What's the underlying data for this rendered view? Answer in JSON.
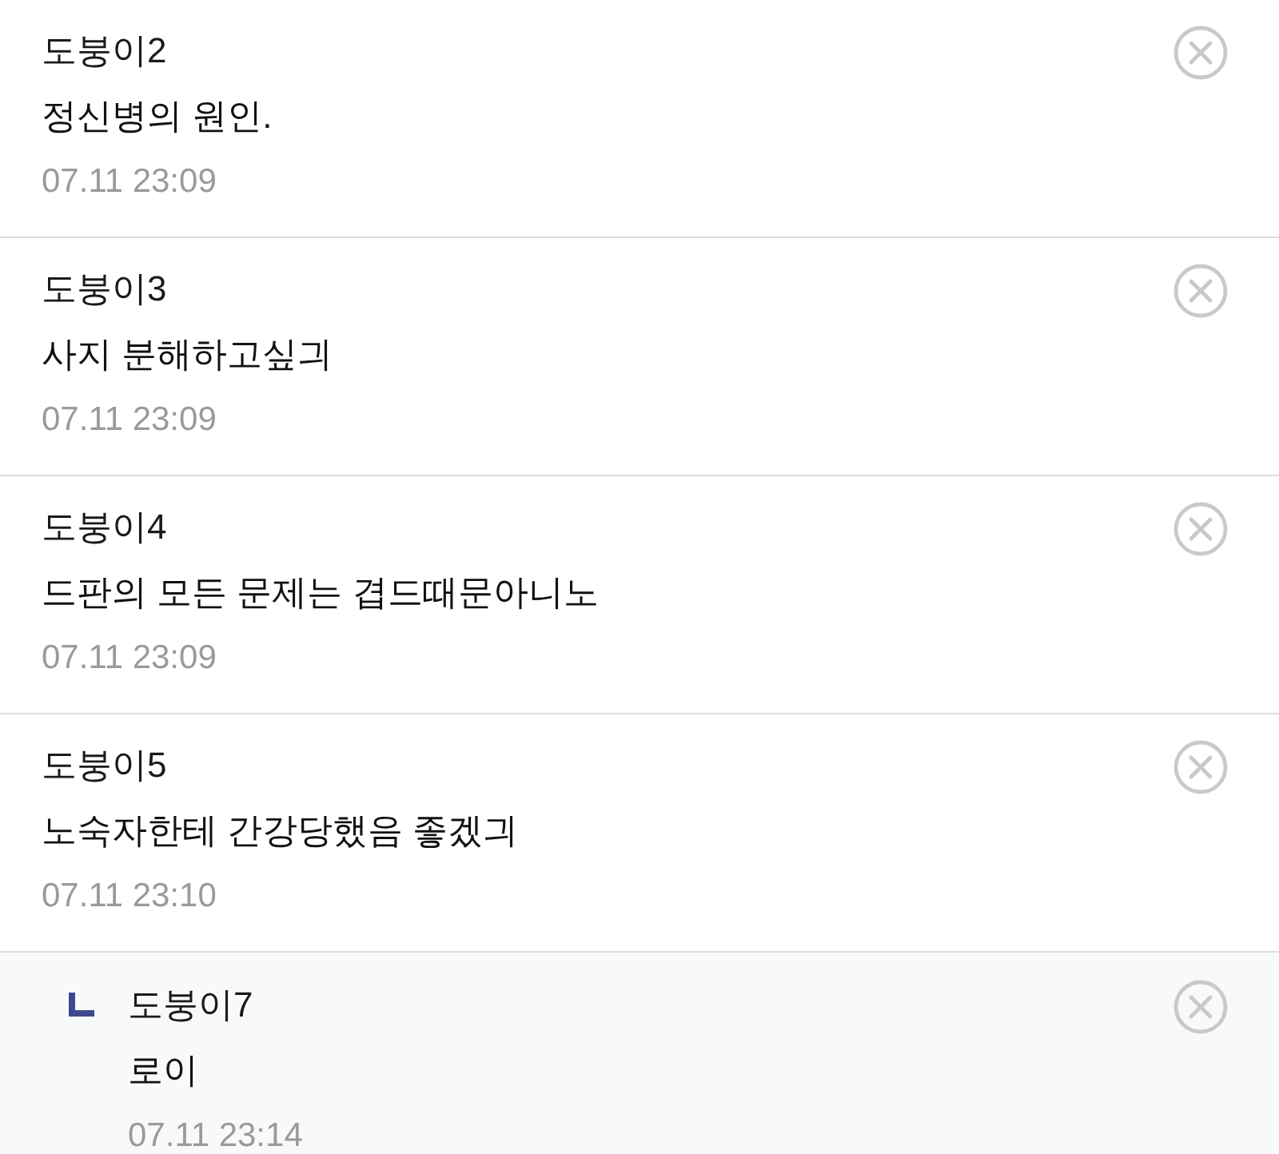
{
  "comments": [
    {
      "kind": "comment",
      "author": "도붕이2",
      "text": "정신병의 원인.",
      "time": "07.11 23:09"
    },
    {
      "kind": "comment",
      "author": "도붕이3",
      "text": "사지 분해하고싶긔",
      "time": "07.11 23:09"
    },
    {
      "kind": "comment",
      "author": "도붕이4",
      "text": "드판의 모든 문제는 겹드때문아니노",
      "time": "07.11 23:09"
    },
    {
      "kind": "comment",
      "author": "도붕이5",
      "text": "노숙자한테 간강당했음 좋겠긔",
      "time": "07.11 23:10"
    },
    {
      "kind": "reply",
      "author": "도붕이7",
      "text": "로이",
      "time": "07.11 23:14"
    }
  ]
}
